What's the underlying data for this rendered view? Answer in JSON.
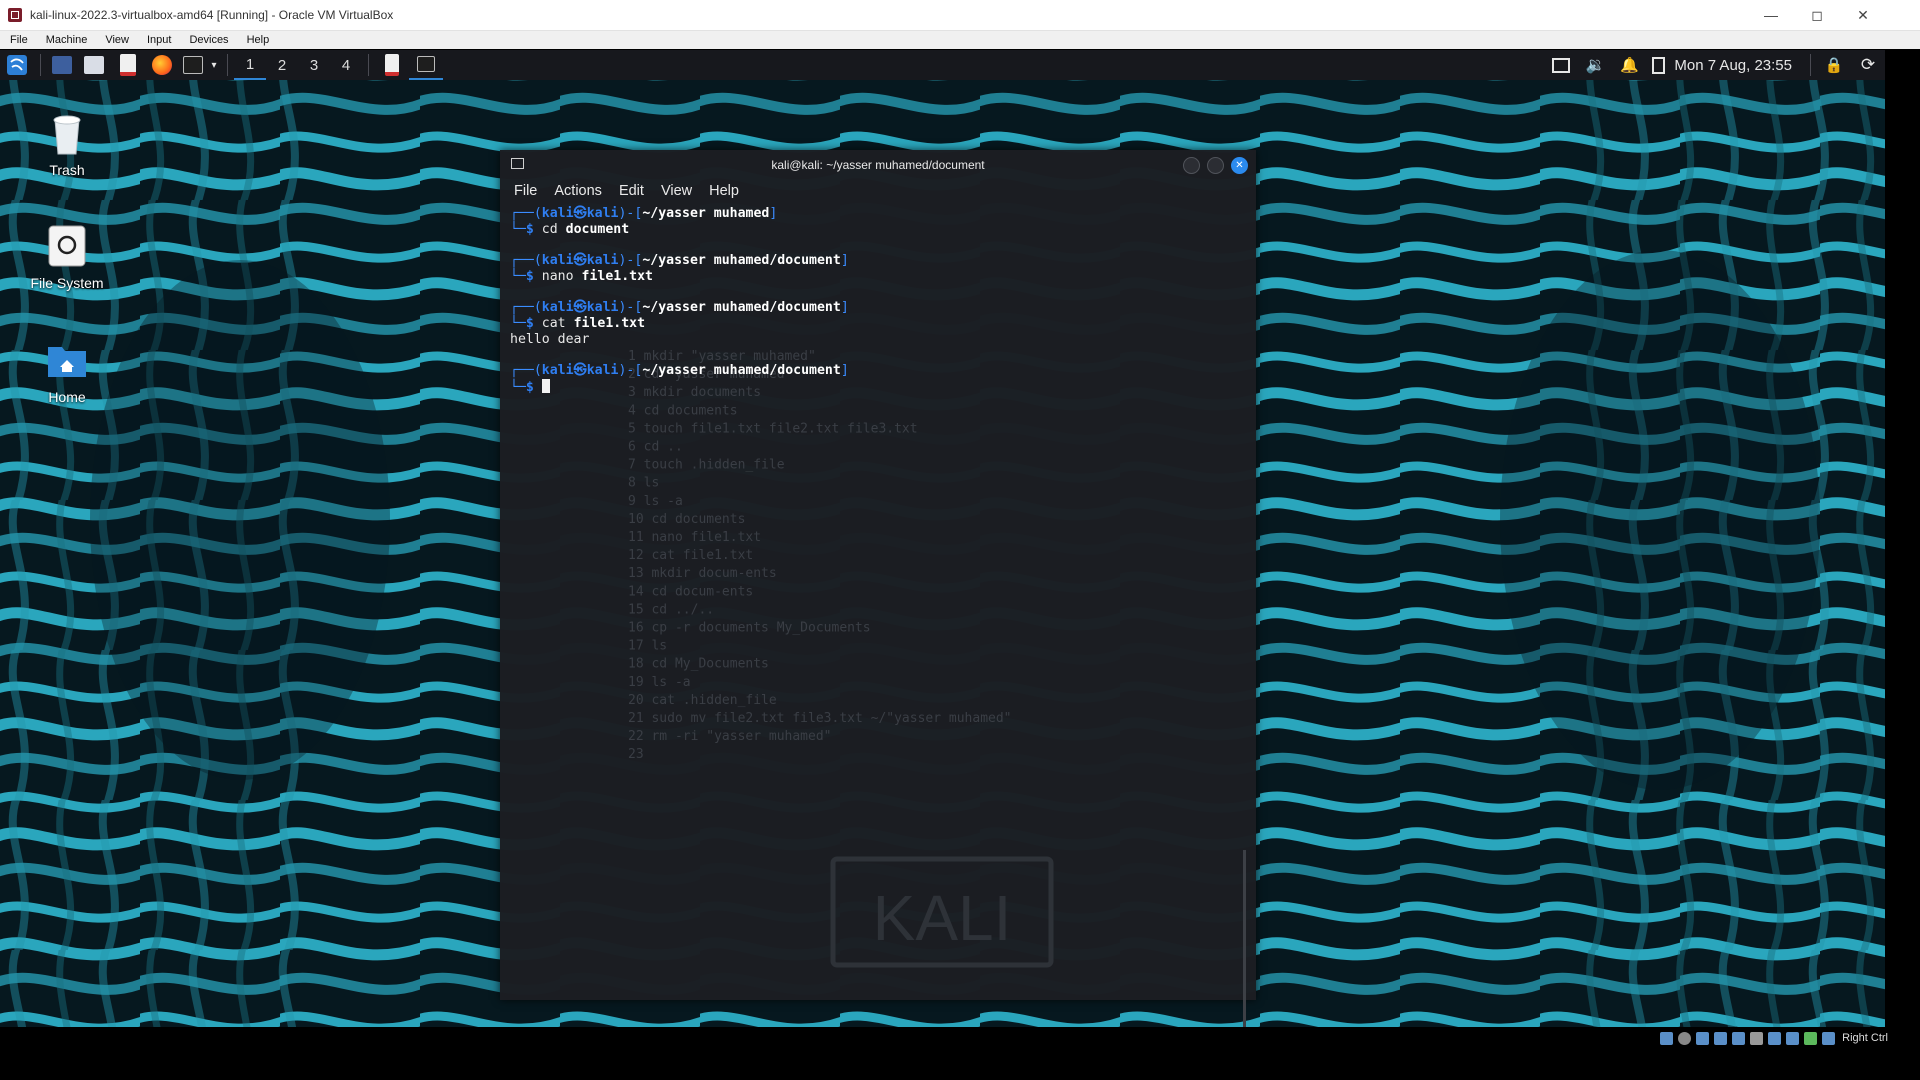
{
  "host": {
    "title": "kali-linux-2022.3-virtualbox-amd64 [Running] - Oracle VM VirtualBox",
    "menu": [
      "File",
      "Machine",
      "View",
      "Input",
      "Devices",
      "Help"
    ],
    "statusbar_key": "Right Ctrl"
  },
  "panel": {
    "workspaces": [
      "1",
      "2",
      "3",
      "4"
    ],
    "active_workspace": "1",
    "clock": "Mon 7 Aug, 23:55"
  },
  "desktop": {
    "icons": [
      {
        "label": "Trash",
        "icon": "trash-icon"
      },
      {
        "label": "File System",
        "icon": "drive-icon"
      },
      {
        "label": "Home",
        "icon": "home-folder-icon"
      }
    ]
  },
  "terminal": {
    "title": "kali@kali: ~/yasser muhamed/document",
    "menu": [
      "File",
      "Actions",
      "Edit",
      "View",
      "Help"
    ],
    "user": "kali",
    "host": "kali",
    "sessions": [
      {
        "path": "~/yasser muhamed",
        "cmd": "cd",
        "arg": "document",
        "output": ""
      },
      {
        "path": "~/yasser muhamed/document",
        "cmd": "nano",
        "arg": "file1.txt",
        "output": ""
      },
      {
        "path": "~/yasser muhamed/document",
        "cmd": "cat",
        "arg": "file1.txt",
        "output": "hello dear"
      },
      {
        "path": "~/yasser muhamed/document",
        "cmd": "",
        "arg": "",
        "output": ""
      }
    ],
    "background_history": [
      "1 mkdir \"yasser muhamed\"",
      "2 cd \"yasser muhamed\"",
      "3 mkdir documents",
      "4 cd documents",
      "5 touch file1.txt file2.txt file3.txt",
      "6 cd ..",
      "7 touch .hidden_file",
      "8 ls",
      "9 ls -a",
      "10 cd documents",
      "11 nano file1.txt",
      "12  cat file1.txt",
      "13 mkdir docum-ents",
      "14 cd docum-ents",
      "15 cd ../..",
      "16 cp -r documents  My_Documents",
      "17 ls",
      "18 cd My_Documents",
      "19 ls -a",
      "20 cat .hidden_file",
      "21 sudo mv file2.txt file3.txt  ~/\"yasser muhamed\"",
      "22 rm -ri \"yasser muhamed\"",
      "23"
    ],
    "watermark": "KALI"
  },
  "colors": {
    "wallpaper_dark": "#06181f",
    "wallpaper_cyan": "#2aa6bd",
    "prompt_blue": "#2f7ef1",
    "close_button": "#2b8bef"
  }
}
